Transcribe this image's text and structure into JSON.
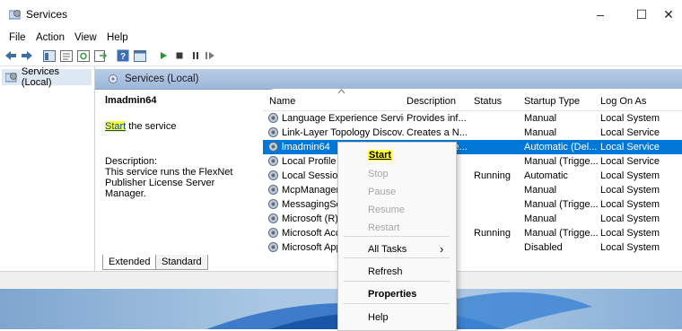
{
  "window": {
    "title": "Services",
    "controls": [
      "–",
      "☐",
      "✕"
    ]
  },
  "menu": [
    "File",
    "Action",
    "View",
    "Help"
  ],
  "tree": {
    "node": "Services (Local)"
  },
  "main": {
    "header": "Services (Local)",
    "service_name": "lmadmin64",
    "start_link": "Start",
    "start_suffix": " the service",
    "description_label": "Description:",
    "description_text": "This service runs the FlexNet Publisher License Server Manager."
  },
  "list": {
    "columns": [
      "Name",
      "Description",
      "Status",
      "Startup Type",
      "Log On As"
    ],
    "rows": [
      {
        "name": "Language Experience Service",
        "desc": "Provides inf...",
        "status": "",
        "startup": "Manual",
        "logon": "Local System",
        "selected": false
      },
      {
        "name": "Link-Layer Topology Discov...",
        "desc": "Creates a N...",
        "status": "",
        "startup": "Manual",
        "logon": "Local Service",
        "selected": false
      },
      {
        "name": "lmadmin64",
        "desc": "This service...",
        "status": "",
        "startup": "Automatic (Del...",
        "logon": "Local Service",
        "selected": true
      },
      {
        "name": "Local Profile A",
        "desc": "...",
        "status": "",
        "startup": "Manual (Trigge...",
        "logon": "Local Service",
        "selected": false
      },
      {
        "name": "Local Session",
        "desc": "...",
        "status": "Running",
        "startup": "Automatic",
        "logon": "Local System",
        "selected": false
      },
      {
        "name": "McpManagen",
        "desc": "...",
        "status": "",
        "startup": "Manual",
        "logon": "Local System",
        "selected": false
      },
      {
        "name": "MessagingSer",
        "desc": "...",
        "status": "",
        "startup": "Manual (Trigge...",
        "logon": "Local System",
        "selected": false
      },
      {
        "name": "Microsoft (R)",
        "desc": "...",
        "status": "",
        "startup": "Manual",
        "logon": "Local System",
        "selected": false
      },
      {
        "name": "Microsoft Acc",
        "desc": "...",
        "status": "Running",
        "startup": "Manual (Trigge...",
        "logon": "Local System",
        "selected": false
      },
      {
        "name": "Microsoft App",
        "desc": "...",
        "status": "",
        "startup": "Disabled",
        "logon": "Local System",
        "selected": false
      }
    ]
  },
  "tabs": [
    "Extended",
    "Standard"
  ],
  "context_menu": {
    "start": "Start",
    "stop": "Stop",
    "pause": "Pause",
    "resume": "Resume",
    "restart": "Restart",
    "all_tasks": "All Tasks",
    "all_tasks_arrow": "›",
    "refresh": "Refresh",
    "properties": "Properties",
    "help": "Help"
  },
  "colors": {
    "selection": "#0078d7",
    "highlight": "#ffff33",
    "header_gradient": "#b9cde6"
  },
  "icons": [
    "services-icon",
    "back-icon",
    "forward-icon",
    "play-icon",
    "stop-icon",
    "pause-icon",
    "resume-icon",
    "gear-icon"
  ]
}
